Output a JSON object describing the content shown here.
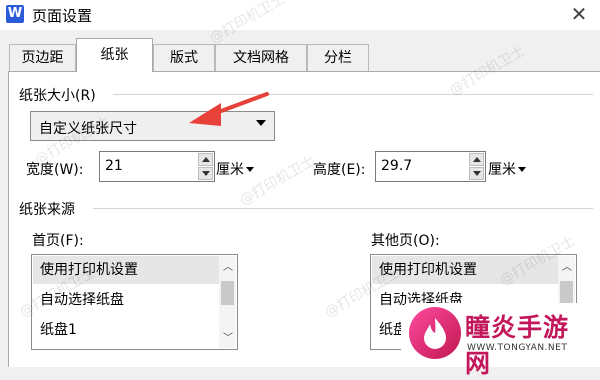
{
  "window": {
    "title": "页面设置",
    "app_icon": "W",
    "close": "✕"
  },
  "tabs": [
    {
      "label": "页边距",
      "active": false
    },
    {
      "label": "纸张",
      "active": true
    },
    {
      "label": "版式",
      "active": false
    },
    {
      "label": "文档网格",
      "active": false
    },
    {
      "label": "分栏",
      "active": false
    }
  ],
  "paper_size": {
    "label": "纸张大小(R)",
    "selected": "自定义纸张尺寸",
    "width_label": "宽度(W):",
    "width_value": "21",
    "width_unit": "厘米",
    "height_label": "高度(E):",
    "height_value": "29.7",
    "height_unit": "厘米"
  },
  "paper_source": {
    "label": "纸张来源",
    "first_page": {
      "label": "首页(F):",
      "items": [
        "使用打印机设置",
        "自动选择纸盘",
        "纸盘1"
      ]
    },
    "other_pages": {
      "label": "其他页(O):",
      "items": [
        "使用打印机设置",
        "自动选择纸盘",
        "纸盘1"
      ]
    }
  },
  "watermark_text": "@打印机卫士",
  "brand": {
    "name": "瞳炎手游网",
    "url": "WWW.TONGYAN.NET"
  },
  "colors": {
    "annotation_arrow": "#e8413a",
    "selection_bg": "#e6e6e6",
    "app_icon": "#2b5bd7",
    "brand": "#c2185b"
  }
}
